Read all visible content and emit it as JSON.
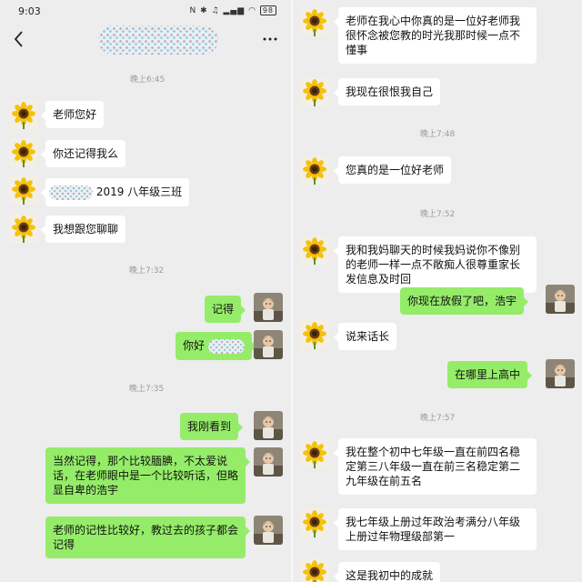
{
  "status_bar": {
    "time": "9:03",
    "icons": [
      "nfc-icon",
      "bluetooth-icon",
      "mute-icon",
      "signal-icon",
      "signal-icon",
      "wifi-icon"
    ],
    "battery": "98"
  },
  "header": {
    "contact_name_masked": true,
    "back_icon": "back-chevron-icon",
    "more_icon": "more-dots-icon"
  },
  "left_chat": {
    "timestamps": [
      "晚上6:45",
      "晚上7:32",
      "晚上7:35"
    ],
    "messages": [
      {
        "side": "in",
        "text": "老师您好"
      },
      {
        "side": "in",
        "text": "你还记得我么"
      },
      {
        "side": "in",
        "text": "2019 八年级三班",
        "masked_prefix": true
      },
      {
        "side": "in",
        "text": "我想跟您聊聊"
      },
      {
        "side": "out",
        "text": "记得"
      },
      {
        "side": "out",
        "text": "你好",
        "masked_suffix": true
      },
      {
        "side": "out",
        "text": "我刚看到"
      },
      {
        "side": "out",
        "text": "当然记得，那个比较腼腆，不太爱说话，在老师眼中是一个比较听话，但略显自卑的浩宇"
      },
      {
        "side": "out",
        "text": "老师的记性比较好，教过去的孩子都会记得"
      }
    ]
  },
  "right_chat": {
    "timestamps": [
      "晚上7:48",
      "晚上7:52",
      "晚上7:57"
    ],
    "messages": [
      {
        "side": "in",
        "text": "老师在我心中你真的是一位好老师我很怀念被您教的时光我那时候一点不懂事"
      },
      {
        "side": "in",
        "text": "我现在很恨我自己"
      },
      {
        "side": "in",
        "text": "您真的是一位好老师"
      },
      {
        "side": "in",
        "text": "我和我妈聊天的时候我妈说你不像别的老师一样一点不敞痴人很尊重家长发信息及时回"
      },
      {
        "side": "out",
        "text": "你现在放假了吧，浩宇"
      },
      {
        "side": "in",
        "text": "说来话长"
      },
      {
        "side": "out",
        "text": "在哪里上高中"
      },
      {
        "side": "in",
        "text": "我在整个初中七年级一直在前四名稳定第三八年级一直在前三名稳定第二九年级在前五名"
      },
      {
        "side": "in",
        "text": "我七年级上册过年政治考满分八年级上册过年物理级部第一"
      },
      {
        "side": "in",
        "text": "这是我初中的成就"
      }
    ]
  },
  "colors": {
    "background": "#ededed",
    "incoming_bubble": "#ffffff",
    "outgoing_bubble": "#95ec69",
    "timestamp": "#9b9b9b"
  }
}
